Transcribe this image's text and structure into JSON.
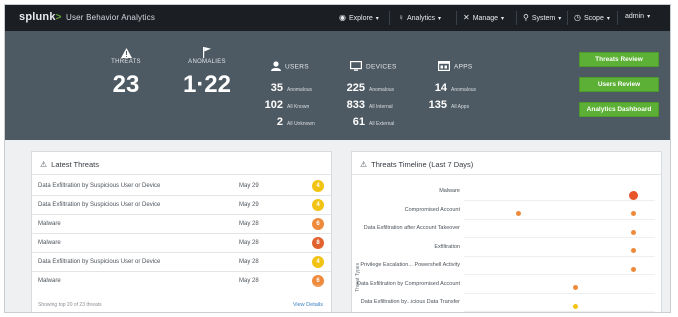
{
  "app": {
    "brand": "splunk",
    "brand_chevron": ">",
    "product": "User Behavior Analytics"
  },
  "nav": [
    {
      "icon": "eye-icon",
      "glyph": "◉",
      "label": "Explore"
    },
    {
      "icon": "lightbulb-icon",
      "glyph": "♀",
      "label": "Analytics"
    },
    {
      "icon": "tools-icon",
      "glyph": "✕",
      "label": "Manage"
    },
    {
      "icon": "search-icon",
      "glyph": "⚲",
      "label": "System"
    },
    {
      "icon": "clock-icon",
      "glyph": "◷",
      "label": "Scope"
    },
    {
      "icon": "",
      "glyph": "",
      "label": "admin"
    }
  ],
  "summary": {
    "threats": {
      "label": "THREATS",
      "value": "23"
    },
    "anomalies": {
      "label": "ANOMALIES",
      "value": "1·22"
    },
    "users": {
      "label": "USERS",
      "rows": [
        {
          "value": "35",
          "text": "Anomalous"
        },
        {
          "value": "102",
          "text": "All Known"
        },
        {
          "value": "2",
          "text": "All Unknown"
        }
      ]
    },
    "devices": {
      "label": "DEVICES",
      "rows": [
        {
          "value": "225",
          "text": "Anomalous"
        },
        {
          "value": "833",
          "text": "All Internal"
        },
        {
          "value": "61",
          "text": "All External"
        }
      ]
    },
    "apps": {
      "label": "APPS",
      "rows": [
        {
          "value": "14",
          "text": "Anomalous"
        },
        {
          "value": "135",
          "text": "All Apps"
        }
      ]
    },
    "buttons": [
      "Threats Review",
      "Users Review",
      "Analytics Dashboard"
    ]
  },
  "latest_threats": {
    "title": "Latest Threats",
    "rows": [
      {
        "name": "Data Exfiltration by Suspicious User or Device",
        "date": "May 29",
        "score": "4",
        "color": "#f2c313"
      },
      {
        "name": "Data Exfiltration by Suspicious User or Device",
        "date": "May 29",
        "score": "4",
        "color": "#f2c313"
      },
      {
        "name": "Malware",
        "date": "May 28",
        "score": "6",
        "color": "#ef8a3c"
      },
      {
        "name": "Malware",
        "date": "May 28",
        "score": "8",
        "color": "#e2622f"
      },
      {
        "name": "Data Exfiltration by Suspicious User or Device",
        "date": "May 28",
        "score": "4",
        "color": "#f2c313"
      },
      {
        "name": "Malware",
        "date": "May 28",
        "score": "6",
        "color": "#ef8a3c"
      }
    ],
    "footer": "Showing top 20 of 23 threats",
    "view_details": "View Details"
  },
  "timeline": {
    "title": "Threats Timeline (Last 7 Days)",
    "y_axis": "Threat Types",
    "rows": [
      {
        "label": "Malware",
        "dots": [
          {
            "day": 0.88,
            "size": "large",
            "color": "#e8552a"
          }
        ]
      },
      {
        "label": "Compromised Account",
        "dots": [
          {
            "day": 0.28,
            "size": "small",
            "color": "#ef8a3c"
          },
          {
            "day": 0.88,
            "size": "small",
            "color": "#ef8a3c"
          }
        ]
      },
      {
        "label": "Data Exfiltration after Account Takeover",
        "dots": [
          {
            "day": 0.88,
            "size": "small",
            "color": "#ef8a3c"
          }
        ]
      },
      {
        "label": "Exfiltration",
        "dots": [
          {
            "day": 0.88,
            "size": "small",
            "color": "#ef8a3c"
          }
        ]
      },
      {
        "label": "Privilege Escalation... Powershell Activity",
        "dots": [
          {
            "day": 0.88,
            "size": "small",
            "color": "#ef8a3c"
          }
        ]
      },
      {
        "label": "Data Exfiltration by Compromised Account",
        "dots": [
          {
            "day": 0.58,
            "size": "small",
            "color": "#ef8a3c"
          }
        ]
      },
      {
        "label": "Data Exfiltration by...icious Data Transfer",
        "dots": [
          {
            "day": 0.58,
            "size": "small",
            "color": "#f2c313"
          }
        ]
      }
    ]
  }
}
